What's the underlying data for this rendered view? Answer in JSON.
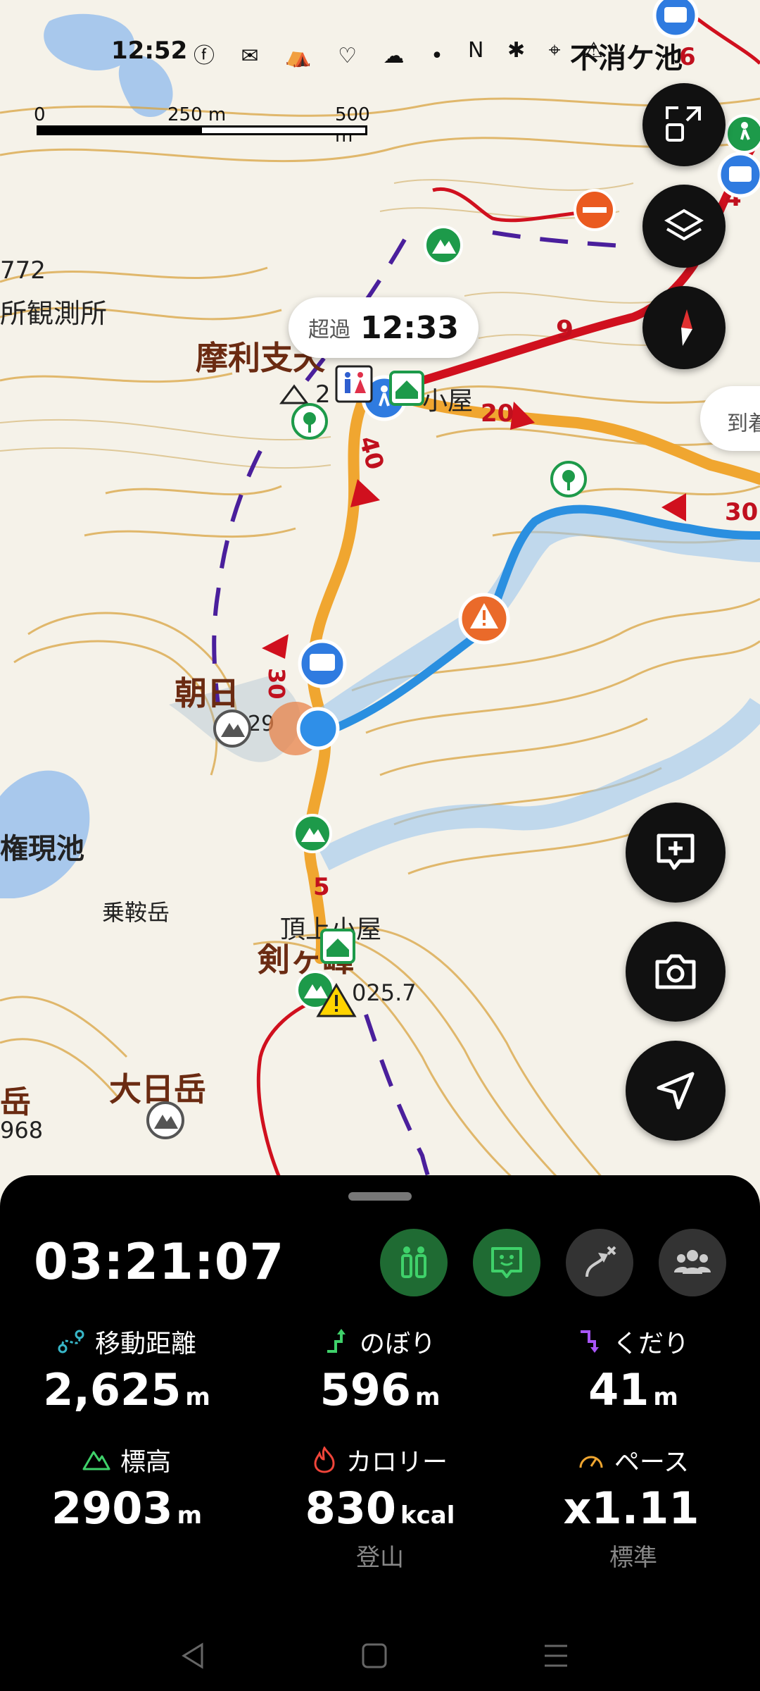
{
  "status_bar": {
    "time": "12:52",
    "left_icons": "ⓕ ✉ ⛺ ♡ ☁ •",
    "right_icons": "N ✱ ⌖ ⚠",
    "place": "不消ケ池"
  },
  "scale": {
    "l0": "0",
    "l1": "250 m",
    "l2": "500 m"
  },
  "tooltip": {
    "key": "超過",
    "value": "12:33"
  },
  "tooltip2": {
    "text": "到着"
  },
  "map_labels": {
    "peak1": "摩利支天",
    "peak1_elev": "2",
    "hut1": "小屋",
    "peak2": "朝日",
    "peak2_elev": "29",
    "pond": "権現池",
    "norikura": "乗鞍岳",
    "summit_hut": "頂上小屋",
    "summit": "剣ヶ峰",
    "summit_elev": "025.7",
    "dainichi": "大日岳",
    "dainichi_elev": "968",
    "elev_left": "772",
    "observatory": "所観測所",
    "dake": "岳",
    "n20": "20",
    "n30": "30",
    "n40": "40",
    "n9": "9",
    "n4": "4",
    "n5": "5",
    "n6": "6",
    "n30b": "30"
  },
  "panel": {
    "elapsed": "03:21:07",
    "stats": [
      {
        "label": "移動距離",
        "value": "2,625",
        "unit": "m",
        "sub": ""
      },
      {
        "label": "のぼり",
        "value": "596",
        "unit": "m",
        "sub": ""
      },
      {
        "label": "くだり",
        "value": "41",
        "unit": "m",
        "sub": ""
      },
      {
        "label": "標高",
        "value": "2903",
        "unit": "m",
        "sub": ""
      },
      {
        "label": "カロリー",
        "value": "830",
        "unit": "kcal",
        "sub": "登山"
      },
      {
        "label": "ペース",
        "value": "x1.11",
        "unit": "",
        "sub": "標準"
      }
    ]
  },
  "colors": {
    "route_orange": "#f0a630",
    "track_blue": "#2a8fe0",
    "route_red": "#d0101e",
    "accent_green": "#3fd16a",
    "contour": "#d9a441"
  }
}
